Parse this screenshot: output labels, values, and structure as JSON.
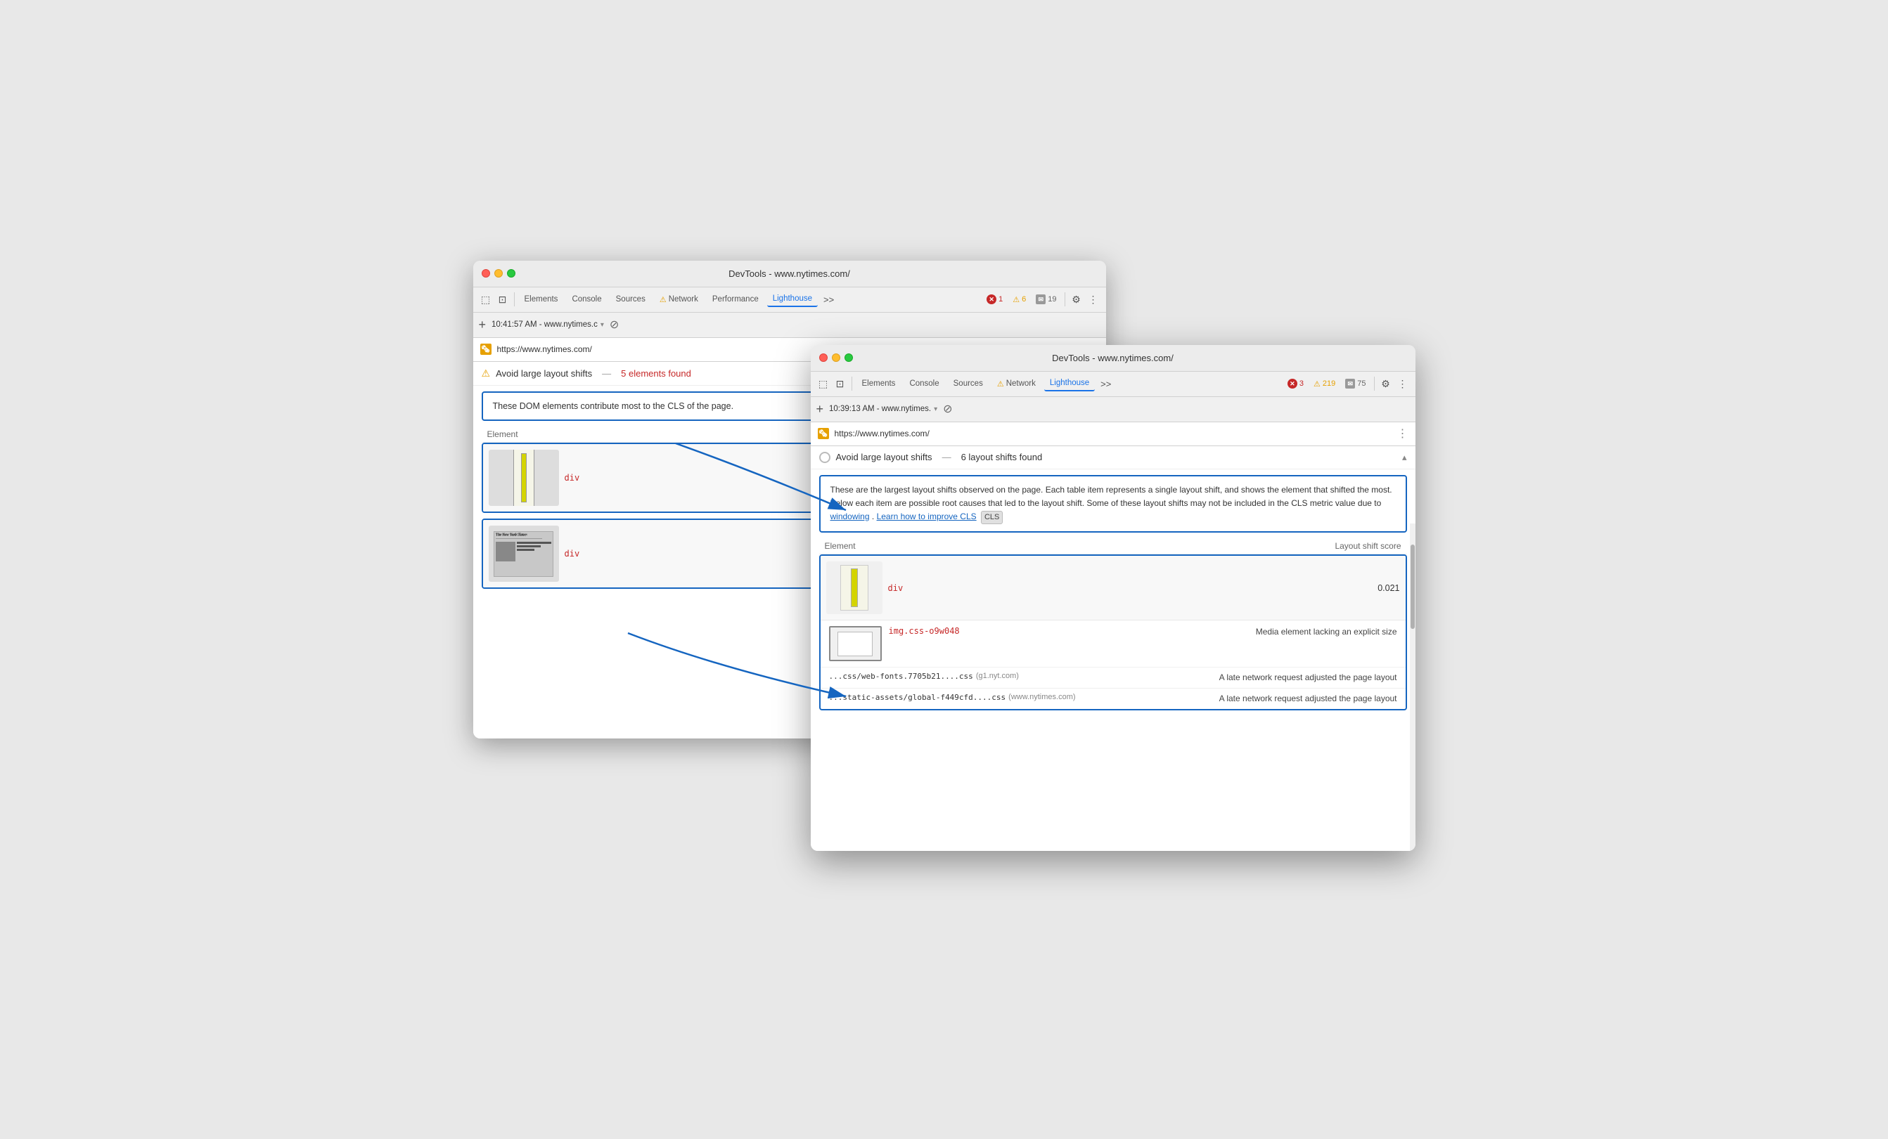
{
  "backWindow": {
    "title": "DevTools - www.nytimes.com/",
    "trafficLights": [
      "red",
      "yellow",
      "green"
    ],
    "toolbar": {
      "tabs": [
        {
          "label": "Elements",
          "active": false
        },
        {
          "label": "Console",
          "active": false
        },
        {
          "label": "Sources",
          "active": false
        },
        {
          "label": "Network",
          "active": false,
          "hasWarning": true
        },
        {
          "label": "Performance",
          "active": false
        },
        {
          "label": "Lighthouse",
          "active": true
        }
      ],
      "more": ">>",
      "badges": {
        "errors": "1",
        "warnings": "6",
        "messages": "19"
      }
    },
    "urlBar": {
      "plus": "+",
      "timestamp": "10:41:57 AM - www.nytimes.c",
      "noEntry": "⊘"
    },
    "urlDisplay": {
      "url": "https://www.nytimes.com/"
    },
    "content": {
      "auditTitle": "Avoid large layout shifts",
      "auditDash": "—",
      "auditCount": "5 elements found",
      "descText": "These DOM elements contribute most to the CLS of the page.",
      "tableHeader": "Element",
      "rows": [
        {
          "label": "div",
          "hasImage": true
        },
        {
          "label": "div",
          "hasImage": true
        }
      ]
    }
  },
  "frontWindow": {
    "title": "DevTools - www.nytimes.com/",
    "trafficLights": [
      "red",
      "yellow",
      "green"
    ],
    "toolbar": {
      "tabs": [
        {
          "label": "Elements",
          "active": false
        },
        {
          "label": "Console",
          "active": false
        },
        {
          "label": "Sources",
          "active": false
        },
        {
          "label": "Network",
          "active": false,
          "hasWarning": true
        },
        {
          "label": "Lighthouse",
          "active": true
        }
      ],
      "more": ">>",
      "badges": {
        "errors": "3",
        "warnings": "219",
        "messages": "75"
      }
    },
    "urlBar": {
      "plus": "+",
      "timestamp": "10:39:13 AM - www.nytimes.",
      "noEntry": "⊘"
    },
    "urlDisplay": {
      "url": "https://www.nytimes.com/"
    },
    "content": {
      "auditTitle": "Avoid large layout shifts",
      "auditDash": "—",
      "auditCount": "6 layout shifts found",
      "descText": "These are the largest layout shifts observed on the page. Each table item represents a single layout shift, and shows the element that shifted the most. Below each item are possible root causes that led to the layout shift. Some of these layout shifts may not be included in the CLS metric value due to",
      "descLink1": "windowing",
      "descMid": ". ",
      "descLink2": "Learn how to improve CLS",
      "clsBadge": "CLS",
      "tableHeaders": {
        "element": "Element",
        "score": "Layout shift score"
      },
      "rows": [
        {
          "elementLabel": "div",
          "score": "0.021",
          "subItems": [
            {
              "elementLabel": "img.css-o9w048",
              "reason": "Media element lacking an explicit size"
            },
            {
              "resourceUrl": "...css/web-fonts.7705b21....css",
              "resourceDomain": "(g1.nyt.com)",
              "reason": "A late network request adjusted the page layout"
            },
            {
              "resourceUrl": "...static-assets/global-f449cfd....css",
              "resourceDomain": "(www.nytimes.com)",
              "reason": "A late network request adjusted the page layout"
            }
          ]
        }
      ]
    }
  },
  "icons": {
    "cursor": "⬚",
    "layers": "⊡",
    "gear": "⚙",
    "more": "⋮",
    "chevronDown": "▾",
    "chevronUp": "▴",
    "noEntry": "⊘",
    "warning": "⚠",
    "error": "✕"
  }
}
